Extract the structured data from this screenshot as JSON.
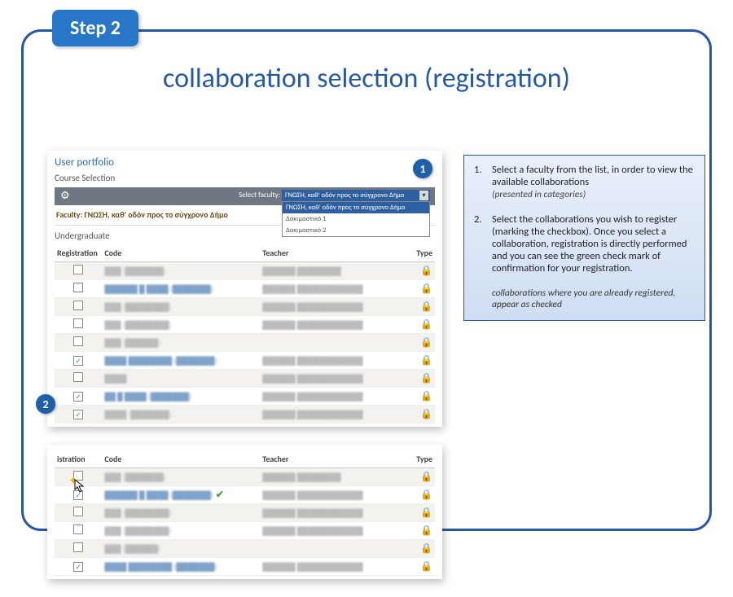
{
  "step_badge": "Step 2",
  "title": "collaboration selection (registration)",
  "bubbles": {
    "b1": "1",
    "b2": "2"
  },
  "panel": {
    "user_portfolio": "User portfolio",
    "course_selection": "Course Selection",
    "select_label": "Select faculty:",
    "select_current": "ΓΝΩΣΗ, καθ' οδόν προς το σύγχρονο Δήμο",
    "dropdown": [
      "ΓΝΩΣΗ, καθ' οδόν προς το σύγχρονο Δήμο",
      "Δοκιμαστικό 1",
      "Δοκιμαστικό 2"
    ],
    "faculty_line": "Faculty: ΓΝΩΣΗ, καθ' οδόν προς το σύγχρονο Δήμο",
    "undergrad": "Undergraduate",
    "headers": {
      "reg": "Registration",
      "code": "Code",
      "teacher": "Teacher",
      "type": "Type"
    },
    "rows1": [
      {
        "checked": false,
        "code": "███  (███████)",
        "link": false,
        "teacher": "██████ ████████"
      },
      {
        "checked": false,
        "code": "██████ █ ████ (███████)",
        "link": true,
        "teacher": "██████ ████████████"
      },
      {
        "checked": false,
        "code": "███ (████████)",
        "link": false,
        "teacher": "██████ ████████████"
      },
      {
        "checked": false,
        "code": "███ (████████)",
        "link": false,
        "teacher": "██████ ████████████"
      },
      {
        "checked": false,
        "code": "███ (██████)",
        "link": false,
        "teacher": ""
      },
      {
        "checked": true,
        "code": "████ ████████ (███████)",
        "link": true,
        "teacher": "██████ ████████████"
      },
      {
        "checked": false,
        "code": "████",
        "link": false,
        "teacher": "██████ ████████████"
      },
      {
        "checked": true,
        "code": "██ █ ████   (███████)",
        "link": true,
        "teacher": "██████ ████████████"
      },
      {
        "checked": true,
        "code": "████ (███████)",
        "link": false,
        "teacher": "██████ ████████████"
      }
    ],
    "rows2": [
      {
        "checked": false,
        "code": "███  (███████)",
        "link": false,
        "teacher": "██████ ████████",
        "confirm": false
      },
      {
        "checked": true,
        "code": "██████ █ ████ (███████)",
        "link": true,
        "teacher": "██████ ████████████",
        "confirm": true
      },
      {
        "checked": false,
        "code": "███ (████████)",
        "link": false,
        "teacher": "██████ ████████████",
        "confirm": false
      },
      {
        "checked": false,
        "code": "███ (████████)",
        "link": false,
        "teacher": "██████ ████████████",
        "confirm": false
      },
      {
        "checked": false,
        "code": "███ (██████)",
        "link": false,
        "teacher": "",
        "confirm": false
      },
      {
        "checked": true,
        "code": "████ ████████ (███████)",
        "link": true,
        "teacher": "██████ ████████████",
        "confirm": false
      }
    ]
  },
  "instructions": {
    "item1_num": "1.",
    "item1_text": "Select a faculty from the list, in order to view the available collaborations",
    "item1_sub": "(presented in categories)",
    "item2_num": "2.",
    "item2_text": "Select the collaborations you wish to register (marking the checkbox). Once you select a collaboration, registration is directly performed and you can see the green check mark of confirmation for your registration.",
    "note": "collaborations where you are already registered, appear as checked"
  }
}
